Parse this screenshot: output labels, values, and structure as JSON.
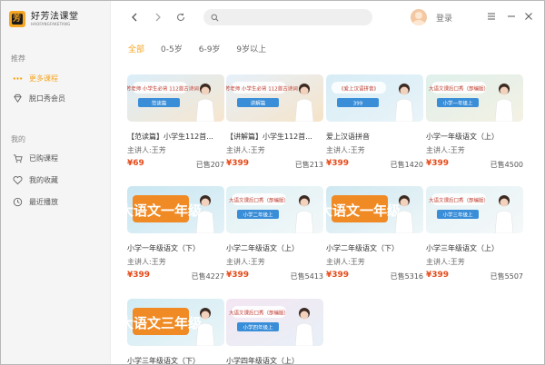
{
  "app": {
    "logo_title": "好芳法课堂",
    "logo_sub": "HAOFANGFAKETANG",
    "logo_glyph": "芳"
  },
  "sidebar": {
    "recommend_label": "推荐",
    "items_top": [
      {
        "label": "更多课程",
        "icon": "dots-icon",
        "active": true
      },
      {
        "label": "脱口秀会员",
        "icon": "diamond-icon",
        "active": false
      }
    ],
    "mine_label": "我的",
    "items_mine": [
      {
        "label": "已购课程",
        "icon": "cart-icon"
      },
      {
        "label": "我的收藏",
        "icon": "heart-icon"
      },
      {
        "label": "最近播放",
        "icon": "clock-icon"
      }
    ]
  },
  "topbar": {
    "search_placeholder": "",
    "login_label": "登录"
  },
  "tabs": [
    {
      "label": "全部",
      "active": true
    },
    {
      "label": "0-5岁",
      "active": false
    },
    {
      "label": "6-9岁",
      "active": false
    },
    {
      "label": "9岁以上",
      "active": false
    }
  ],
  "courses": [
    {
      "title": "【范读篇】小学生112首...",
      "teacher": "主讲人:王芳",
      "price": "¥69",
      "sold": "已售207",
      "thumb_text": "王芳老师 小学生必背 112首古诗词",
      "thumb_tag": "范读篇",
      "bg1": "#dbeefa",
      "bg2": "#f7e6cf"
    },
    {
      "title": "【讲解篇】小学生112首...",
      "teacher": "主讲人:王芳",
      "price": "¥399",
      "sold": "已售213",
      "thumb_text": "王芳老师 小学生必背 112首古诗词",
      "thumb_tag": "讲解篇",
      "bg1": "#e6f1fb",
      "bg2": "#f6e3c8"
    },
    {
      "title": "爱上汉语拼音",
      "teacher": "主讲人:王芳",
      "price": "¥399",
      "sold": "已售1420",
      "thumb_text": "《爱上汉语拼音》",
      "thumb_tag": "399",
      "bg1": "#d7ecf6",
      "bg2": "#e9f4f8"
    },
    {
      "title": "小学一年级语文（上）",
      "teacher": "主讲人:王芳",
      "price": "¥399",
      "sold": "已售4500",
      "thumb_text": "大语文课后口秀（部编版）",
      "thumb_tag": "小学一年级上",
      "bg1": "#dff0ec",
      "bg2": "#f4f1e3"
    },
    {
      "title": "小学一年级语文（下）",
      "teacher": "主讲人:王芳",
      "price": "¥399",
      "sold": "已售4227",
      "thumb_text": "大语文 一年级",
      "thumb_tag": "",
      "bg1": "#c9e6f2",
      "bg2": "#e3f2f7"
    },
    {
      "title": "小学二年级语文（上）",
      "teacher": "主讲人:王芳",
      "price": "¥399",
      "sold": "已售5413",
      "thumb_text": "大语文课后口秀（部编版）",
      "thumb_tag": "小学二年级上",
      "bg1": "#dff1f5",
      "bg2": "#f2f7f8"
    },
    {
      "title": "小学二年级语文（下）",
      "teacher": "主讲人:王芳",
      "price": "¥399",
      "sold": "已售5316",
      "thumb_text": "大语文 一年级",
      "thumb_tag": "",
      "bg1": "#cfe8f1",
      "bg2": "#eef6f8"
    },
    {
      "title": "小学三年级语文（上）",
      "teacher": "主讲人:王芳",
      "price": "¥399",
      "sold": "已售5507",
      "thumb_text": "大语文课后口秀（部编版）",
      "thumb_tag": "小学三年级上",
      "bg1": "#e4f2f6",
      "bg2": "#f5f8f8"
    },
    {
      "title": "小学三年级语文（下）",
      "teacher": "",
      "price": "",
      "sold": "",
      "thumb_text": "大语文 三年级",
      "thumb_tag": "",
      "bg1": "#d1ebf3",
      "bg2": "#eaf5f8"
    },
    {
      "title": "小学四年级语文（上）",
      "teacher": "",
      "price": "",
      "sold": "",
      "thumb_text": "大语文课后口秀（部编版）",
      "thumb_tag": "小学四年级上",
      "bg1": "#f3e6f2",
      "bg2": "#e8f0f7"
    }
  ],
  "colors": {
    "accent": "#f5a623",
    "price": "#e64a19"
  }
}
